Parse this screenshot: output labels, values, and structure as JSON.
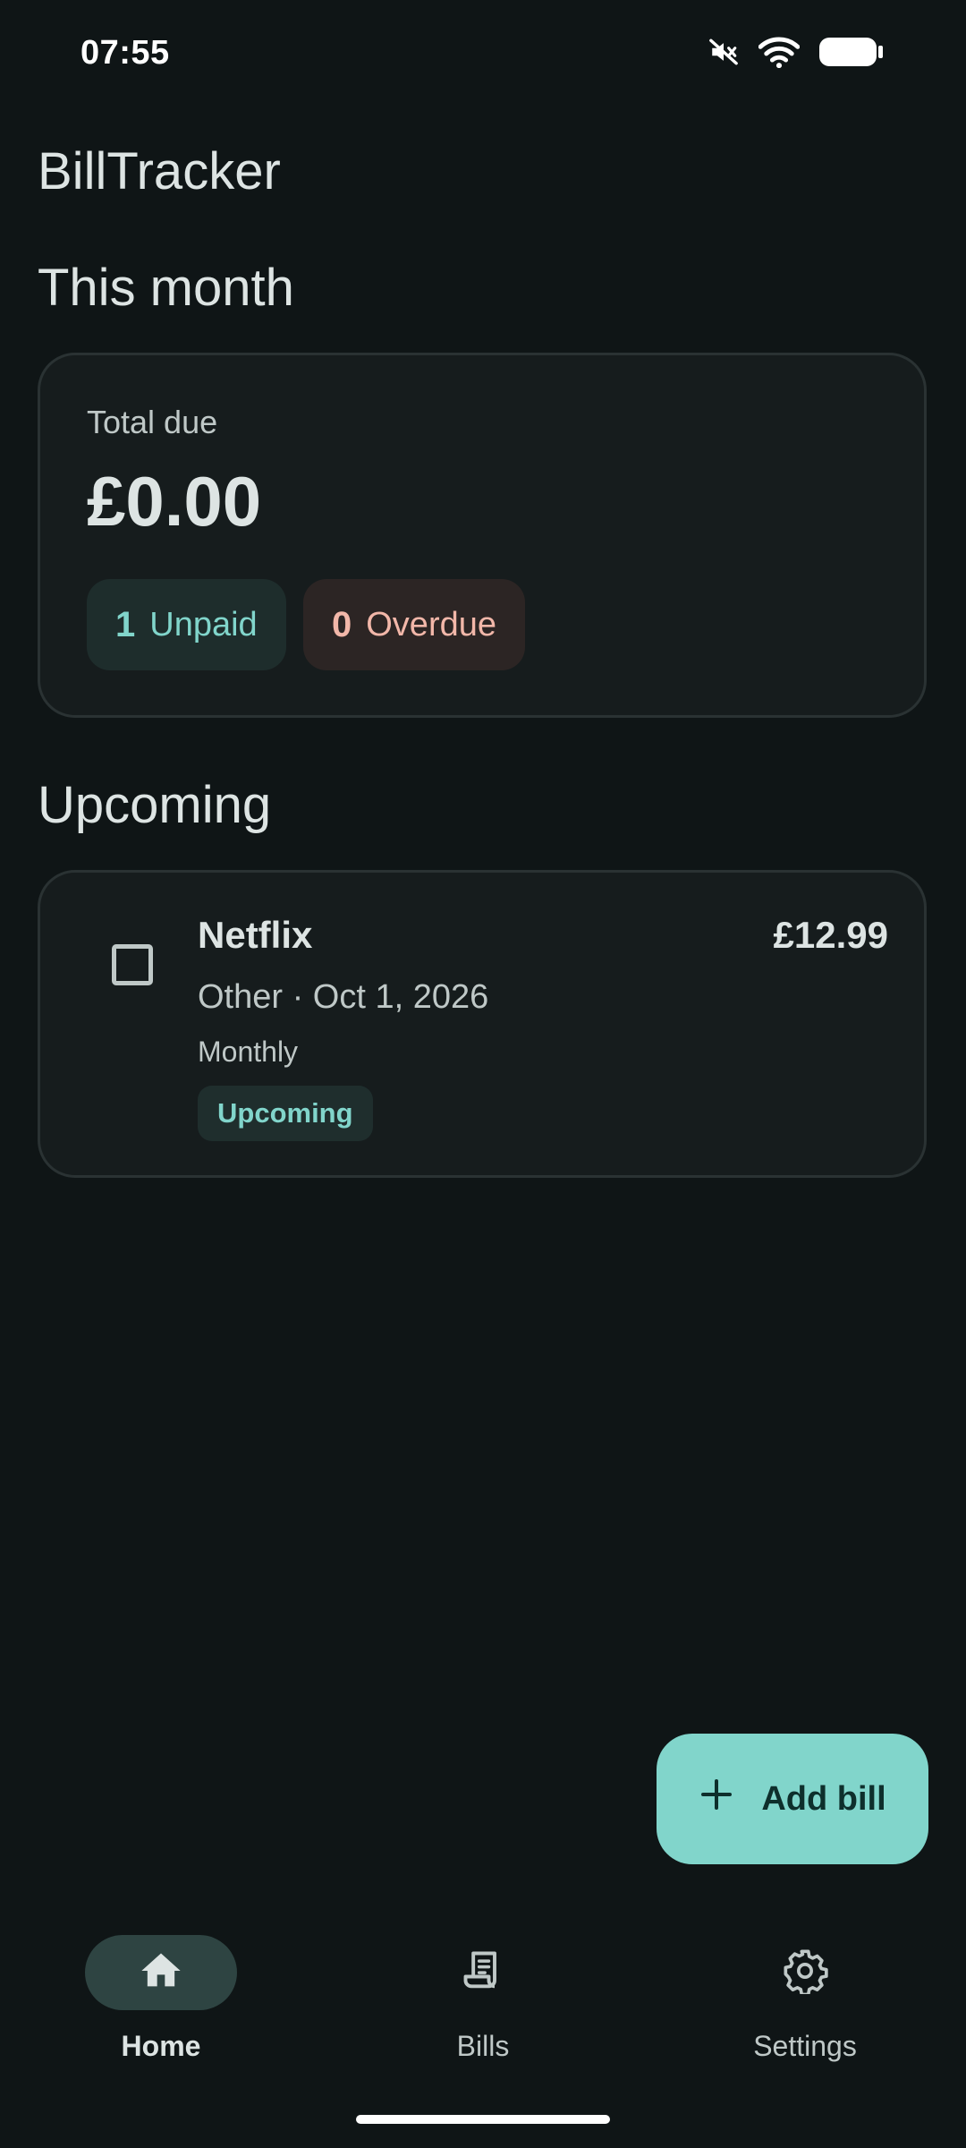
{
  "status_bar": {
    "time": "07:55"
  },
  "app": {
    "title": "BillTracker"
  },
  "summary": {
    "section_title": "This month",
    "total_label": "Total due",
    "total_amount": "£0.00",
    "unpaid_count": "1",
    "unpaid_label": "Unpaid",
    "overdue_count": "0",
    "overdue_label": "Overdue"
  },
  "upcoming": {
    "section_title": "Upcoming",
    "bills": [
      {
        "name": "Netflix",
        "amount": "£12.99",
        "meta": "Other · Oct 1, 2026",
        "frequency": "Monthly",
        "status": "Upcoming",
        "paid": false
      }
    ]
  },
  "fab": {
    "label": "Add bill",
    "icon": "plus-icon"
  },
  "nav": {
    "items": [
      {
        "label": "Home",
        "icon": "home-icon",
        "active": true
      },
      {
        "label": "Bills",
        "icon": "receipt-icon",
        "active": false
      },
      {
        "label": "Settings",
        "icon": "gear-icon",
        "active": false
      }
    ]
  },
  "colors": {
    "background": "#0f1516",
    "accent": "#81d5cb",
    "overdue": "#f2b7a9",
    "card": "#161c1d"
  }
}
